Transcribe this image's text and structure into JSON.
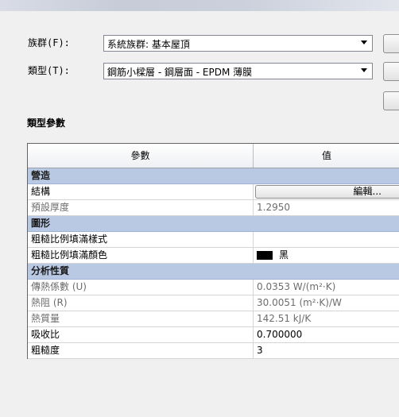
{
  "family_label": "族群(F):",
  "family_value": "系統族群: 基本屋頂",
  "type_label": "類型(T):",
  "type_value": "鋼筋小樑層 - 鋼層面 - EPDM 薄膜",
  "section_title": "類型參數",
  "columns": {
    "param": "參數",
    "value": "值"
  },
  "groups": [
    {
      "name": "營造",
      "rows": [
        {
          "name": "結構",
          "kind": "button",
          "value": "編輯...",
          "dim": false
        },
        {
          "name": "預設厚度",
          "kind": "text",
          "value": "1.2950",
          "dim": true
        }
      ]
    },
    {
      "name": "圖形",
      "rows": [
        {
          "name": "粗糙比例填滿樣式",
          "kind": "text",
          "value": "",
          "dim": false
        },
        {
          "name": "粗糙比例填滿顏色",
          "kind": "color",
          "value": "黑",
          "swatch_color": "#000000",
          "dim": false
        }
      ]
    },
    {
      "name": "分析性質",
      "rows": [
        {
          "name": "傳熱係數 (U)",
          "kind": "text",
          "value": "0.0353 W/(m²·K)",
          "dim": true
        },
        {
          "name": "熱阻 (R)",
          "kind": "text",
          "value": "30.0051 (m²·K)/W",
          "dim": true
        },
        {
          "name": "熱質量",
          "kind": "text",
          "value": "142.51 kJ/K",
          "dim": true
        },
        {
          "name": "吸收比",
          "kind": "text",
          "value": "0.700000",
          "dim": false
        },
        {
          "name": "粗糙度",
          "kind": "text",
          "value": "3",
          "dim": false
        }
      ]
    }
  ],
  "colors": {
    "group_header": "#b9c9e3",
    "dialog_bg": "#f0f0f0",
    "dim_text": "#6d6d6d"
  }
}
